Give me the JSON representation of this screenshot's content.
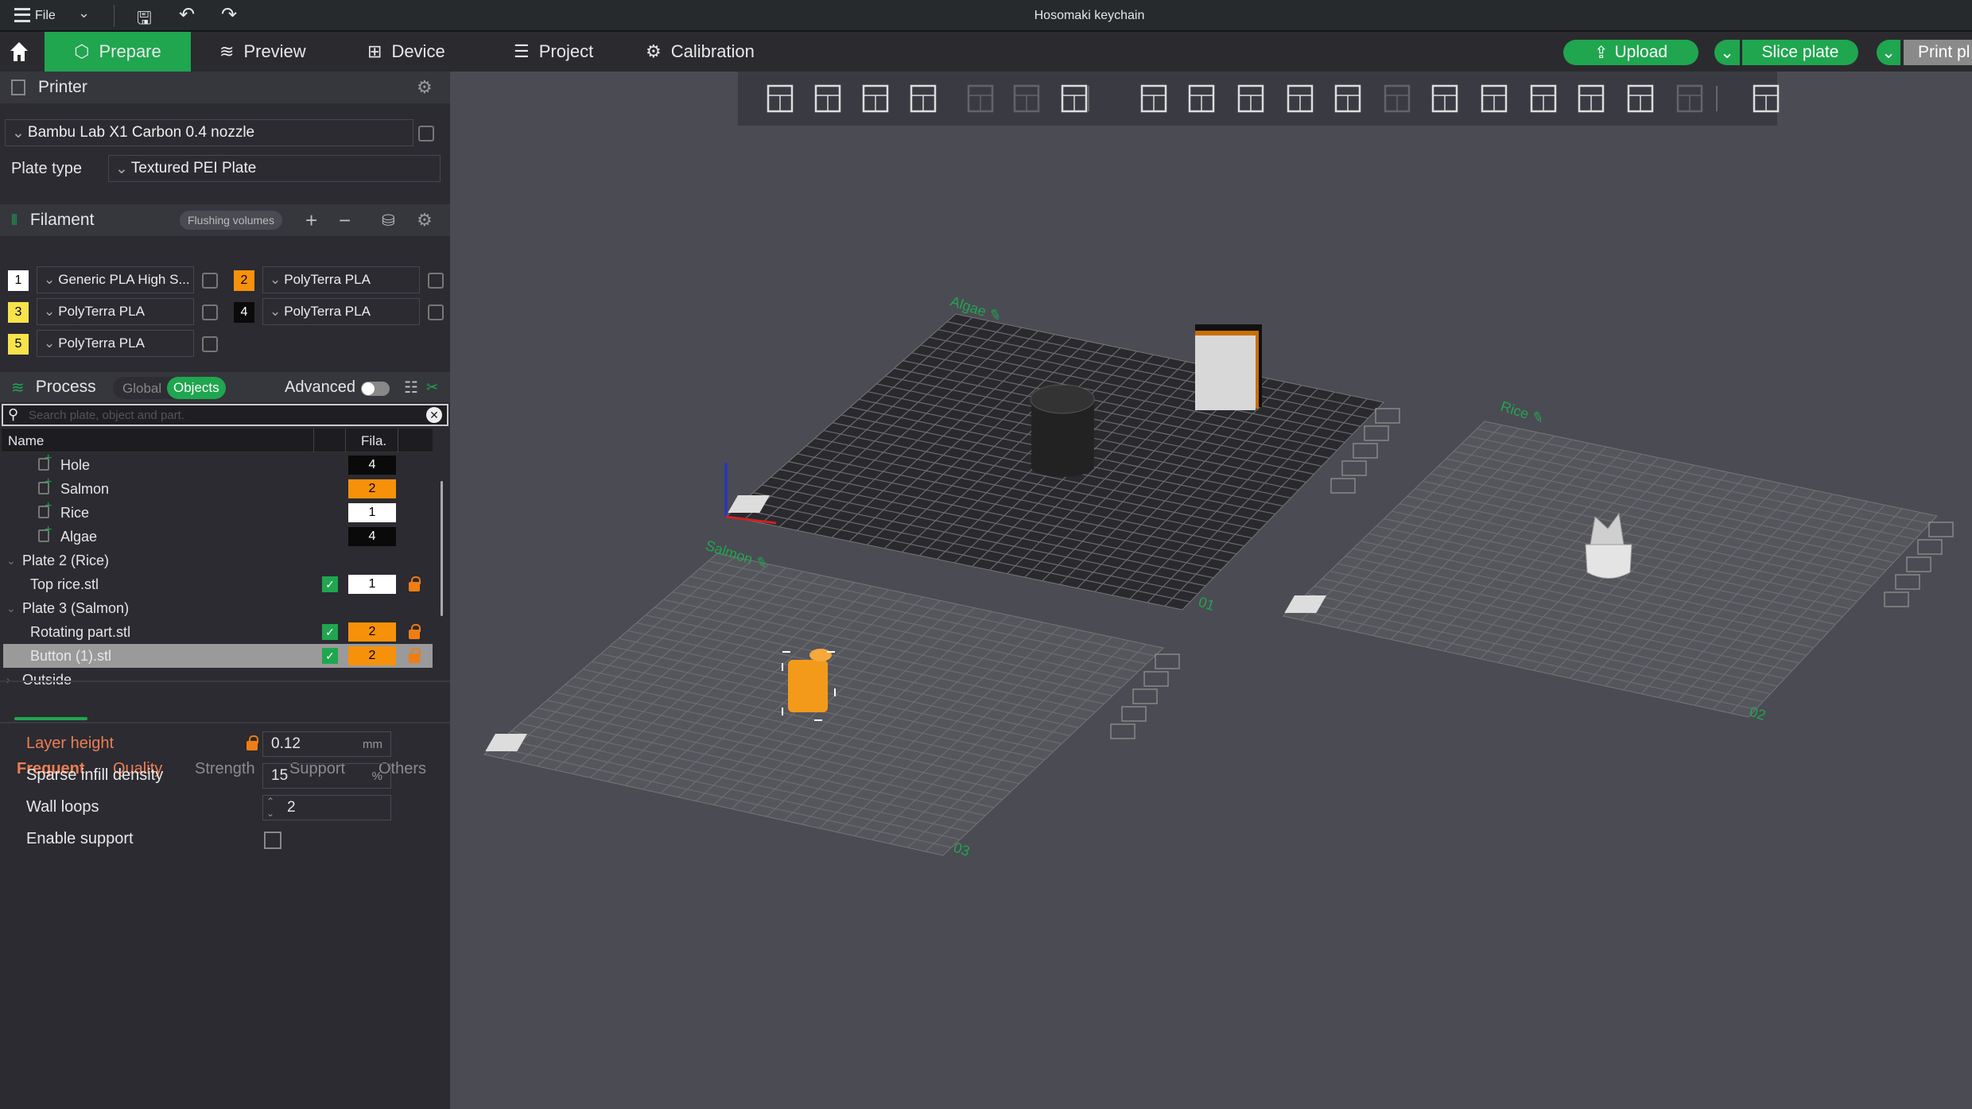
{
  "titlebar": {
    "menu": "File",
    "title": "Hosomaki keychain"
  },
  "tabs": [
    {
      "label": "Prepare",
      "icon": "cube-icon"
    },
    {
      "label": "Preview",
      "icon": "layers-icon"
    },
    {
      "label": "Device",
      "icon": "device-icon"
    },
    {
      "label": "Project",
      "icon": "project-icon"
    },
    {
      "label": "Calibration",
      "icon": "calibration-icon"
    }
  ],
  "actions": {
    "upload": "Upload",
    "slice": "Slice plate",
    "print": "Print pl"
  },
  "printer": {
    "header": "Printer",
    "preset": "Bambu Lab X1 Carbon 0.4 nozzle",
    "plate_type_label": "Plate type",
    "plate_type": "Textured PEI Plate"
  },
  "filament": {
    "header": "Filament",
    "flushing": "Flushing volumes",
    "items": [
      {
        "n": "1",
        "name": "Generic PLA High S...",
        "color": "#ffffff"
      },
      {
        "n": "2",
        "name": "PolyTerra PLA",
        "color": "#f7910a"
      },
      {
        "n": "3",
        "name": "PolyTerra PLA",
        "color": "#f8e34b"
      },
      {
        "n": "4",
        "name": "PolyTerra PLA",
        "color": "#0a0a0a"
      },
      {
        "n": "5",
        "name": "PolyTerra PLA",
        "color": "#f8e34b"
      }
    ]
  },
  "process": {
    "header": "Process",
    "global": "Global",
    "objects": "Objects",
    "advanced": "Advanced",
    "advanced_on": false,
    "search_placeholder": "Search plate, object and part."
  },
  "objects": {
    "col_name": "Name",
    "col_fila": "Fila.",
    "rows": [
      {
        "name": "Hole",
        "level": 2,
        "fila": "4",
        "fcolor": "#0a0a0a"
      },
      {
        "name": "Salmon",
        "level": 2,
        "fila": "2",
        "fcolor": "#f7910a"
      },
      {
        "name": "Rice",
        "level": 2,
        "fila": "1",
        "fcolor": "#ffffff"
      },
      {
        "name": "Algae",
        "level": 2,
        "fila": "4",
        "fcolor": "#0a0a0a"
      },
      {
        "name": "Plate 2 (Rice)",
        "level": 0
      },
      {
        "name": "Top rice.stl",
        "level": 1,
        "fila": "1",
        "fcolor": "#ffffff",
        "check": true,
        "lock": true
      },
      {
        "name": "Plate 3 (Salmon)",
        "level": 0
      },
      {
        "name": "Rotating part.stl",
        "level": 1,
        "fila": "2",
        "fcolor": "#f7910a",
        "check": true,
        "lock": true
      },
      {
        "name": "Button (1).stl",
        "level": 1,
        "fila": "2",
        "fcolor": "#f7910a",
        "check": true,
        "lock": true,
        "selected": true
      },
      {
        "name": "Outside",
        "level": 0,
        "collapsed": true
      }
    ]
  },
  "settings_tabs": [
    "Frequent",
    "Quality",
    "Strength",
    "Support",
    "Others"
  ],
  "settings": {
    "layer_height": {
      "label": "Layer height",
      "value": "0.12",
      "unit": "mm"
    },
    "infill": {
      "label": "Sparse infill density",
      "value": "15",
      "unit": "%"
    },
    "walls": {
      "label": "Wall loops",
      "value": "2"
    },
    "support": {
      "label": "Enable support",
      "checked": false
    }
  },
  "viewport": {
    "plates": [
      {
        "label": "Algae",
        "num": "01"
      },
      {
        "label": "Rice",
        "num": "02"
      },
      {
        "label": "Salmon",
        "num": "03"
      }
    ]
  },
  "colors": {
    "accent": "#1fa64f",
    "warning": "#ef7d14"
  }
}
